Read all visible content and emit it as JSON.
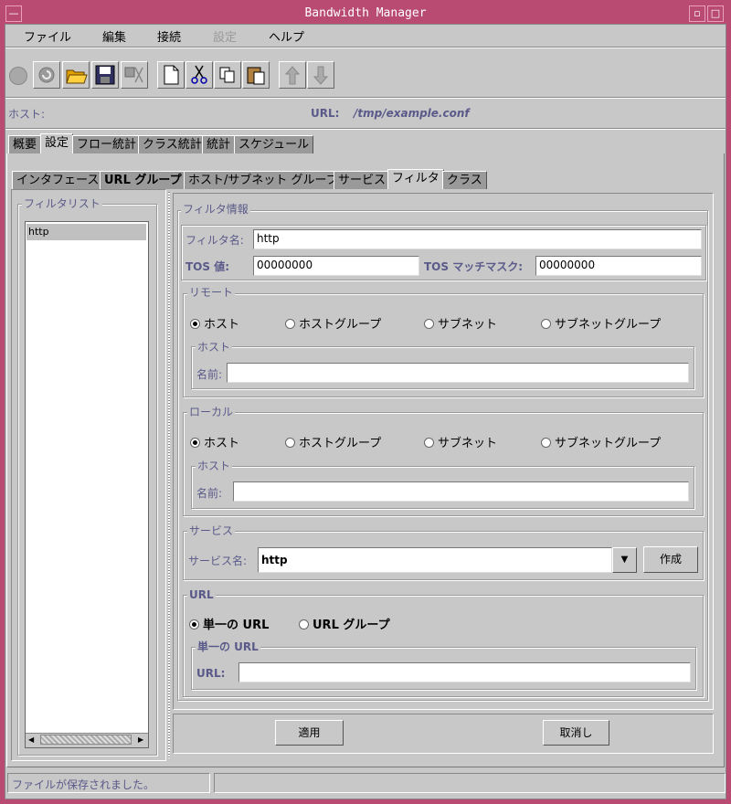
{
  "window": {
    "title": "Bandwidth Manager",
    "min_glyph": "—",
    "max_glyph": "□",
    "close_glyph": "▫"
  },
  "menu": {
    "file": "ファイル",
    "edit": "編集",
    "connect": "接続",
    "settings": "設定",
    "help": "ヘルプ"
  },
  "info": {
    "host_label": "ホスト:",
    "url_label": "URL:",
    "url_value": "/tmp/example.conf"
  },
  "main_tabs": [
    "概要",
    "設定",
    "フロー統計",
    "クラス統計",
    "統計",
    "スケジュール"
  ],
  "sub_tabs": [
    "インタフェース",
    "URL グループ",
    "ホスト/サブネット グループ",
    "サービス",
    "フィルタ",
    "クラス"
  ],
  "filter_list": {
    "title": "フィルタリスト",
    "items": [
      "http"
    ]
  },
  "filter_info": {
    "title": "フィルタ情報",
    "name_label": "フィルタ名:",
    "name_value": "http",
    "tos_label": "TOS 値:",
    "tos_value": "00000000",
    "mask_label": "TOS マッチマスク:",
    "mask_value": "00000000"
  },
  "remote": {
    "title": "リモート",
    "options": [
      "ホスト",
      "ホストグループ",
      "サブネット",
      "サブネットグループ"
    ],
    "selected": "ホスト",
    "sub_title": "ホスト",
    "name_label": "名前:",
    "name_value": ""
  },
  "local": {
    "title": "ローカル",
    "options": [
      "ホスト",
      "ホストグループ",
      "サブネット",
      "サブネットグループ"
    ],
    "selected": "ホスト",
    "sub_title": "ホスト",
    "name_label": "名前:",
    "name_value": ""
  },
  "service": {
    "title": "サービス",
    "name_label": "サービス名:",
    "selected": "http",
    "create_label": "作成"
  },
  "url": {
    "title": "URL",
    "opt_single": "単一の URL",
    "opt_group": "URL グループ",
    "selected": "単一の URL",
    "sub_title": "単一の URL",
    "url_label": "URL:",
    "url_value": ""
  },
  "actions": {
    "apply": "適用",
    "cancel": "取消し"
  },
  "status": {
    "message": "ファイルが保存されました。",
    "secondary": ""
  },
  "colors": {
    "frame": "#b94a72",
    "background": "#c8c8c8",
    "label_blue": "#5a5a8a"
  }
}
